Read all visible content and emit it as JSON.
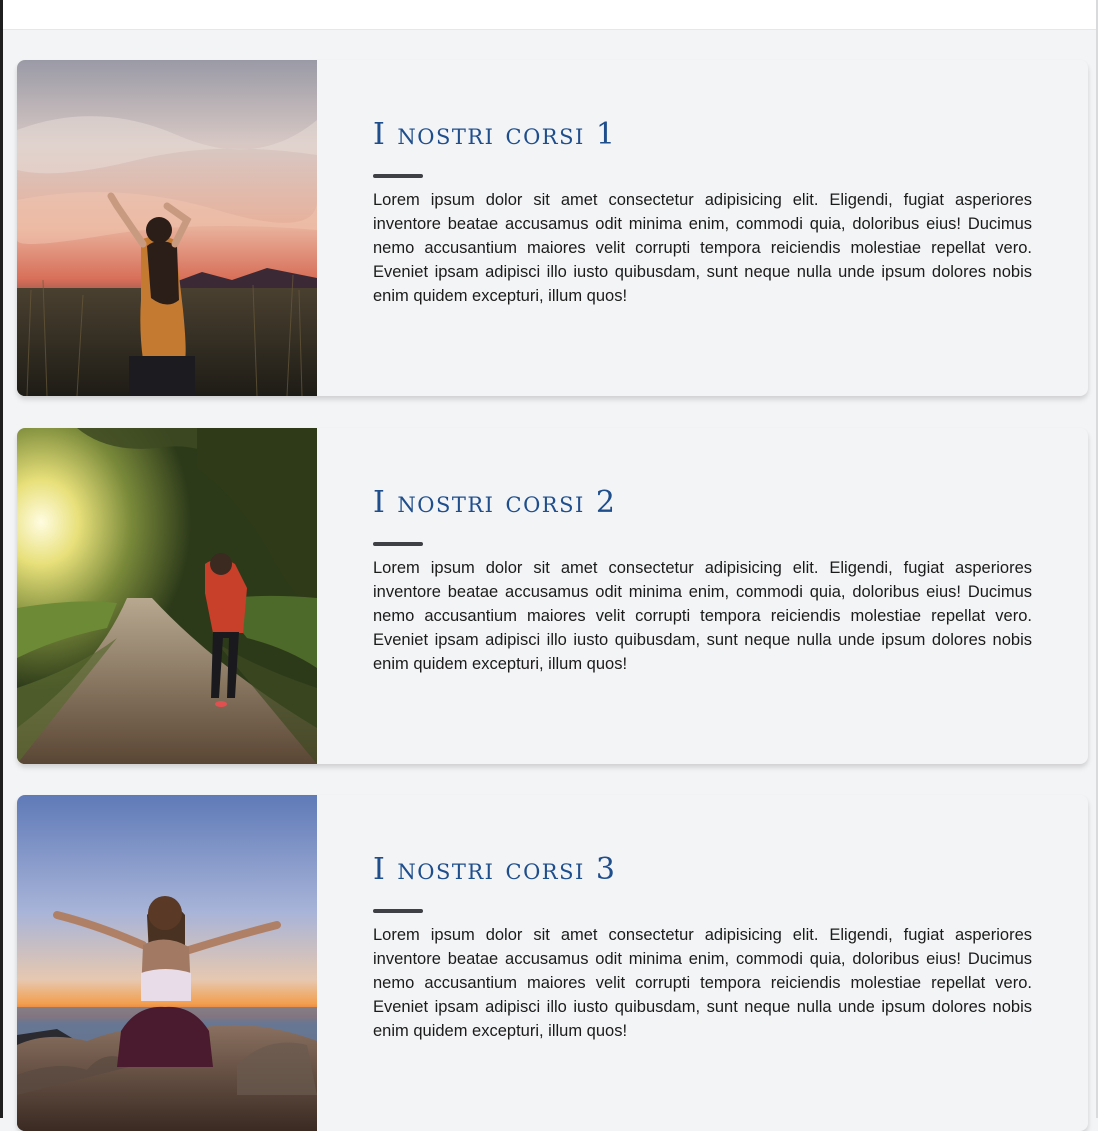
{
  "courses": [
    {
      "title": "I nostri corsi 1",
      "description": "Lorem ipsum dolor sit amet consectetur adipisicing elit. Eligendi, fugiat asperiores inventore beatae accusamus odit minima enim, commodi quia, doloribus eius! Ducimus nemo accusantium maiores velit corrupti tempora reiciendis molestiae repellat vero. Eveniet ipsam adipisci illo iusto quibusdam, sunt neque nulla unde ipsum dolores nobis enim quidem excepturi, illum quos!",
      "image": "woman-arms-raised-field-sunset-photo"
    },
    {
      "title": "I nostri corsi 2",
      "description": "Lorem ipsum dolor sit amet consectetur adipisicing elit. Eligendi, fugiat asperiores inventore beatae accusamus odit minima enim, commodi quia, doloribus eius! Ducimus nemo accusantium maiores velit corrupti tempora reiciendis molestiae repellat vero. Eveniet ipsam adipisci illo iusto quibusdam, sunt neque nulla unde ipsum dolores nobis enim quidem excepturi, illum quos!",
      "image": "woman-walking-country-road-photo"
    },
    {
      "title": "I nostri corsi 3",
      "description": "Lorem ipsum dolor sit amet consectetur adipisicing elit. Eligendi, fugiat asperiores inventore beatae accusamus odit minima enim, commodi quia, doloribus eius! Ducimus nemo accusantium maiores velit corrupti tempora reiciendis molestiae repellat vero. Eveniet ipsam adipisci illo iusto quibusdam, sunt neque nulla unde ipsum dolores nobis enim quidem excepturi, illum quos!",
      "image": "woman-arms-open-seaside-sunset-photo"
    }
  ],
  "colors": {
    "title": "#1f4e8c",
    "divider": "#3f3f46",
    "card_background": "#f3f4f6",
    "text": "#1b1b1b"
  }
}
